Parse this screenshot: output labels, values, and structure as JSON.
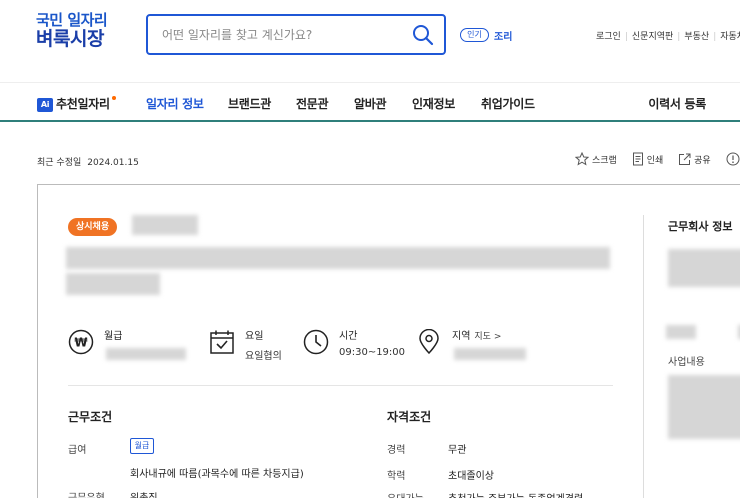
{
  "header": {
    "logo_line1": "국민 일자리",
    "logo_line2": "벼룩시장",
    "search_placeholder": "어떤 일자리를 찾고 계신가요?",
    "popular_badge": "인기",
    "popular_keyword": "조리",
    "util_links": [
      "로그인",
      "신문지역판",
      "부동산",
      "자동차"
    ]
  },
  "nav": {
    "ai_badge": "Ai",
    "items": [
      "추천일자리",
      "일자리 정보",
      "브랜드관",
      "전문관",
      "알바관",
      "인재정보",
      "취업가이드"
    ],
    "active_index": 1,
    "resume": "이력서 등록"
  },
  "meta": {
    "updated_label": "최근 수정일",
    "updated_date": "2024.01.15",
    "actions": [
      "스크랩",
      "인쇄",
      "공유"
    ]
  },
  "job": {
    "badge": "상시채용",
    "info": [
      {
        "label": "월급",
        "value": ""
      },
      {
        "label": "요일",
        "value": "요일협의"
      },
      {
        "label": "시간",
        "value": "09:30~19:00"
      },
      {
        "label": "지역",
        "link": "지도 >",
        "value": ""
      }
    ]
  },
  "conditions": {
    "title": "근무조건",
    "pay_label": "급여",
    "pay_tag": "월급",
    "pay_note": "회사내규에 따름(과목수에 따른 차등지급)",
    "type_label": "근무유형",
    "type_value": "위촉직"
  },
  "qualifications": {
    "title": "자격조건",
    "rows": [
      {
        "label": "경력",
        "value": "무관"
      },
      {
        "label": "학력",
        "value": "초대졸이상"
      },
      {
        "label": "우대가능",
        "value": "추천가능 주부가능 동종업계경력"
      }
    ]
  },
  "company": {
    "title": "근무회사 정보",
    "business_label": "사업내용"
  },
  "colors": {
    "brand_blue": "#1f57d6",
    "badge_orange": "#f07324",
    "nav_underline": "#2f7f7b"
  }
}
